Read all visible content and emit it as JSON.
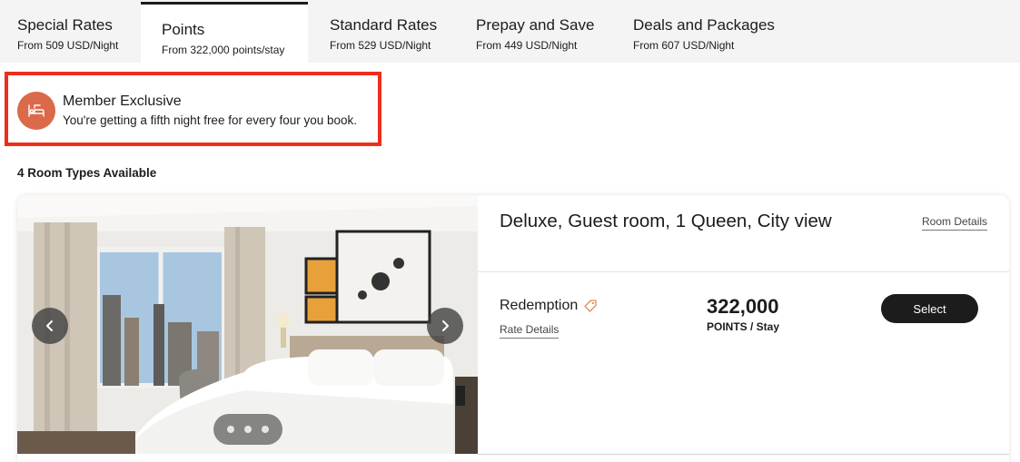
{
  "tabs": [
    {
      "label": "Special Rates",
      "sub": "From 509 USD/Night"
    },
    {
      "label": "Points",
      "sub": "From 322,000 points/stay"
    },
    {
      "label": "Standard Rates",
      "sub": "From 529 USD/Night"
    },
    {
      "label": "Prepay and Save",
      "sub": "From 449 USD/Night"
    },
    {
      "label": "Deals and Packages",
      "sub": "From 607 USD/Night"
    }
  ],
  "active_tab": "Points",
  "banner": {
    "title": "Member Exclusive",
    "text": "You're getting a fifth night free for every four you book.",
    "icon": "bed-icon",
    "icon_color": "#da6a4a",
    "highlight_color": "#ee2d1c"
  },
  "room_count": "4 Room Types Available",
  "room": {
    "title": "Deluxe, Guest room, 1 Queen, City view",
    "details_link": "Room Details",
    "rate_name": "Redemption",
    "rate_icon": "tag-icon",
    "rate_details_link": "Rate Details",
    "price": "322,000",
    "price_unit": "POINTS / Stay",
    "select_label": "Select",
    "gallery": {
      "prev_icon": "chevron-left-icon",
      "next_icon": "chevron-right-icon",
      "dots": 3
    }
  },
  "colors": {
    "accent": "#da6a4a",
    "button": "#1c1c1c",
    "tab_bar": "#f4f4f4"
  }
}
